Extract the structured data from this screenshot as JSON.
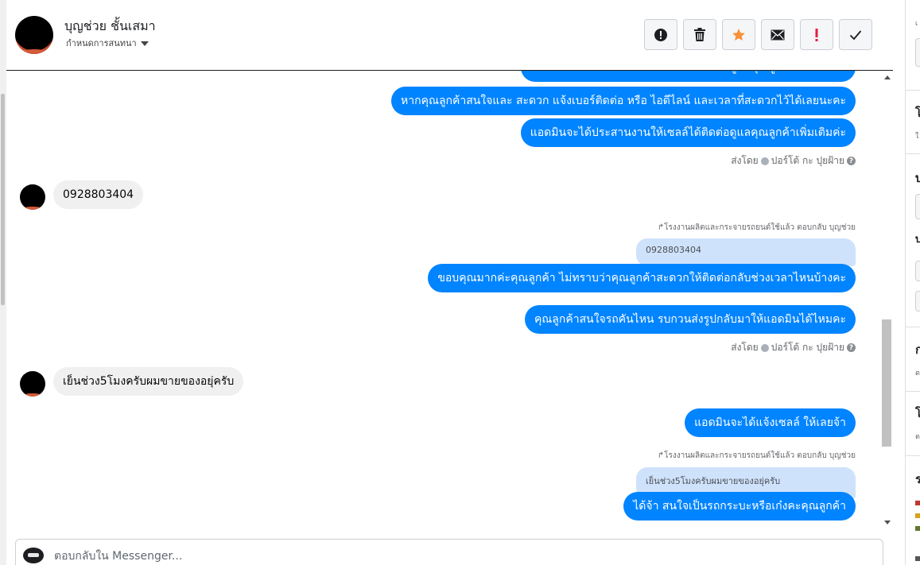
{
  "header": {
    "contact_name": "บุญช่วย ชั้นเสมา",
    "subtitle": "กำหนดการสนทนา",
    "actions": [
      {
        "name": "report-icon",
        "label": "report"
      },
      {
        "name": "trash-icon",
        "label": "delete"
      },
      {
        "name": "star-icon",
        "label": "star"
      },
      {
        "name": "mail-icon",
        "label": "mark unread"
      },
      {
        "name": "exclamation-icon",
        "label": "follow up"
      },
      {
        "name": "check-icon",
        "label": "done"
      }
    ],
    "colors": {
      "star": "#f7923a",
      "exclamation": "#e41e3f"
    }
  },
  "messages": {
    "m0": "แอดมินจะได้ประสานงานให้เซลล์ได้ติดต่อดูแลคุณลูกค้าเพิ่มเติมค่ะ",
    "m1": "หากคุณลูกค้าสนใจและ สะดวก แจ้งเบอร์ติดต่อ หรือ ไอดีไลน์ และเวลาที่สะดวกไว้ได้เลยนะคะ",
    "m2": "แอดมินจะได้ประสานงานให้เซลล์ได้ติดต่อดูแลคุณลูกค้าเพิ่มเติมค่ะ",
    "sent_by_1": "ส่งโดย",
    "sender_1": "ปอร์โต้ กะ ปุยฝ้าย",
    "in1": "0928803404",
    "reply_meta_1": "โรงงานผลิตและกระจายรถยนต์ใช้แล้ว ตอบกลับ บุญช่วย",
    "quote_1": "0928803404",
    "m3": "ขอบคุณมากค่ะคุณลูกค้า ไม่ทราบว่าคุณลูกค้าสะดวกให้ติดต่อกลับช่วงเวลาไหนบ้างคะ",
    "m4": "คุณลูกค้าสนใจรถคันไหน รบกวนส่งรูปกลับมาให้แอดมินได้ไหมคะ",
    "sent_by_2": "ส่งโดย",
    "sender_2": "ปอร์โต้ กะ ปุยฝ้าย",
    "in2": "เย็นช่วง5โมงครับผมขายของอยุ่ครับ",
    "m5": "แอดมินจะได้แจ้งเซลล์ ให้เลยจ้า",
    "reply_meta_2": "โรงงานผลิตและกระจายรถยนต์ใช้แล้ว ตอบกลับ บุญช่วย",
    "quote_2": "เย็นช่วง5โมงครับผมขายของอยุ่ครับ",
    "m6": "ได้จ้า สนใจเป็นรถกระบะหรือเก๋งคะคุณลูกค้า",
    "bubble_color": "#0084ff"
  },
  "composer": {
    "placeholder": "ตอบกลับใน Messenger..."
  }
}
